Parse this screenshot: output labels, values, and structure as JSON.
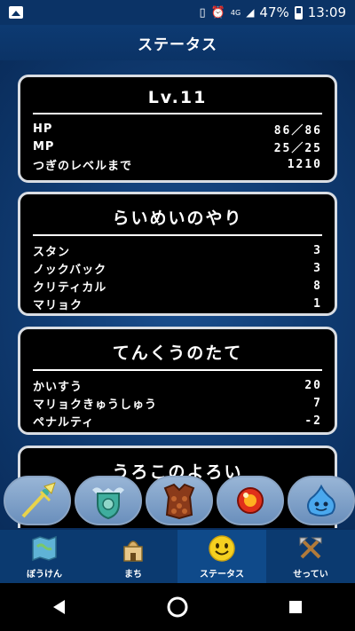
{
  "status_bar": {
    "battery": "47%",
    "time": "13:09",
    "network": "4G"
  },
  "header": {
    "title": "ステータス"
  },
  "level_panel": {
    "title": "Lv.11",
    "rows": [
      {
        "label": "HP",
        "value": "86／86"
      },
      {
        "label": "MP",
        "value": "25／25"
      },
      {
        "label": "つぎのレベルまで",
        "value": "1210"
      }
    ]
  },
  "weapon_panel": {
    "title": "らいめいのやり",
    "rows": [
      {
        "label": "スタン",
        "value": "3"
      },
      {
        "label": "ノックバック",
        "value": "3"
      },
      {
        "label": "クリティカル",
        "value": "8"
      },
      {
        "label": "マリョク",
        "value": "1"
      }
    ]
  },
  "shield_panel": {
    "title": "てんくうのたて",
    "rows": [
      {
        "label": "かいすう",
        "value": "20"
      },
      {
        "label": "マリョクきゅうしゅう",
        "value": "7"
      },
      {
        "label": "ペナルティ",
        "value": "-2"
      }
    ]
  },
  "armor_panel": {
    "title": "うろこのよろい"
  },
  "items": [
    {
      "icon": "spear-icon",
      "color": "#e8d34a"
    },
    {
      "icon": "shield-icon",
      "color": "#3fae9e"
    },
    {
      "icon": "scale-armor-icon",
      "color": "#8a3a1a"
    },
    {
      "icon": "red-orb-icon",
      "color": "#e0301a"
    },
    {
      "icon": "blue-slime-icon",
      "color": "#4aa8ee"
    }
  ],
  "bottom_nav": [
    {
      "label": "ぼうけん",
      "icon": "map-icon"
    },
    {
      "label": "まち",
      "icon": "town-icon"
    },
    {
      "label": "ステータス",
      "icon": "smiley-icon",
      "active": true
    },
    {
      "label": "せってい",
      "icon": "tools-icon"
    }
  ]
}
